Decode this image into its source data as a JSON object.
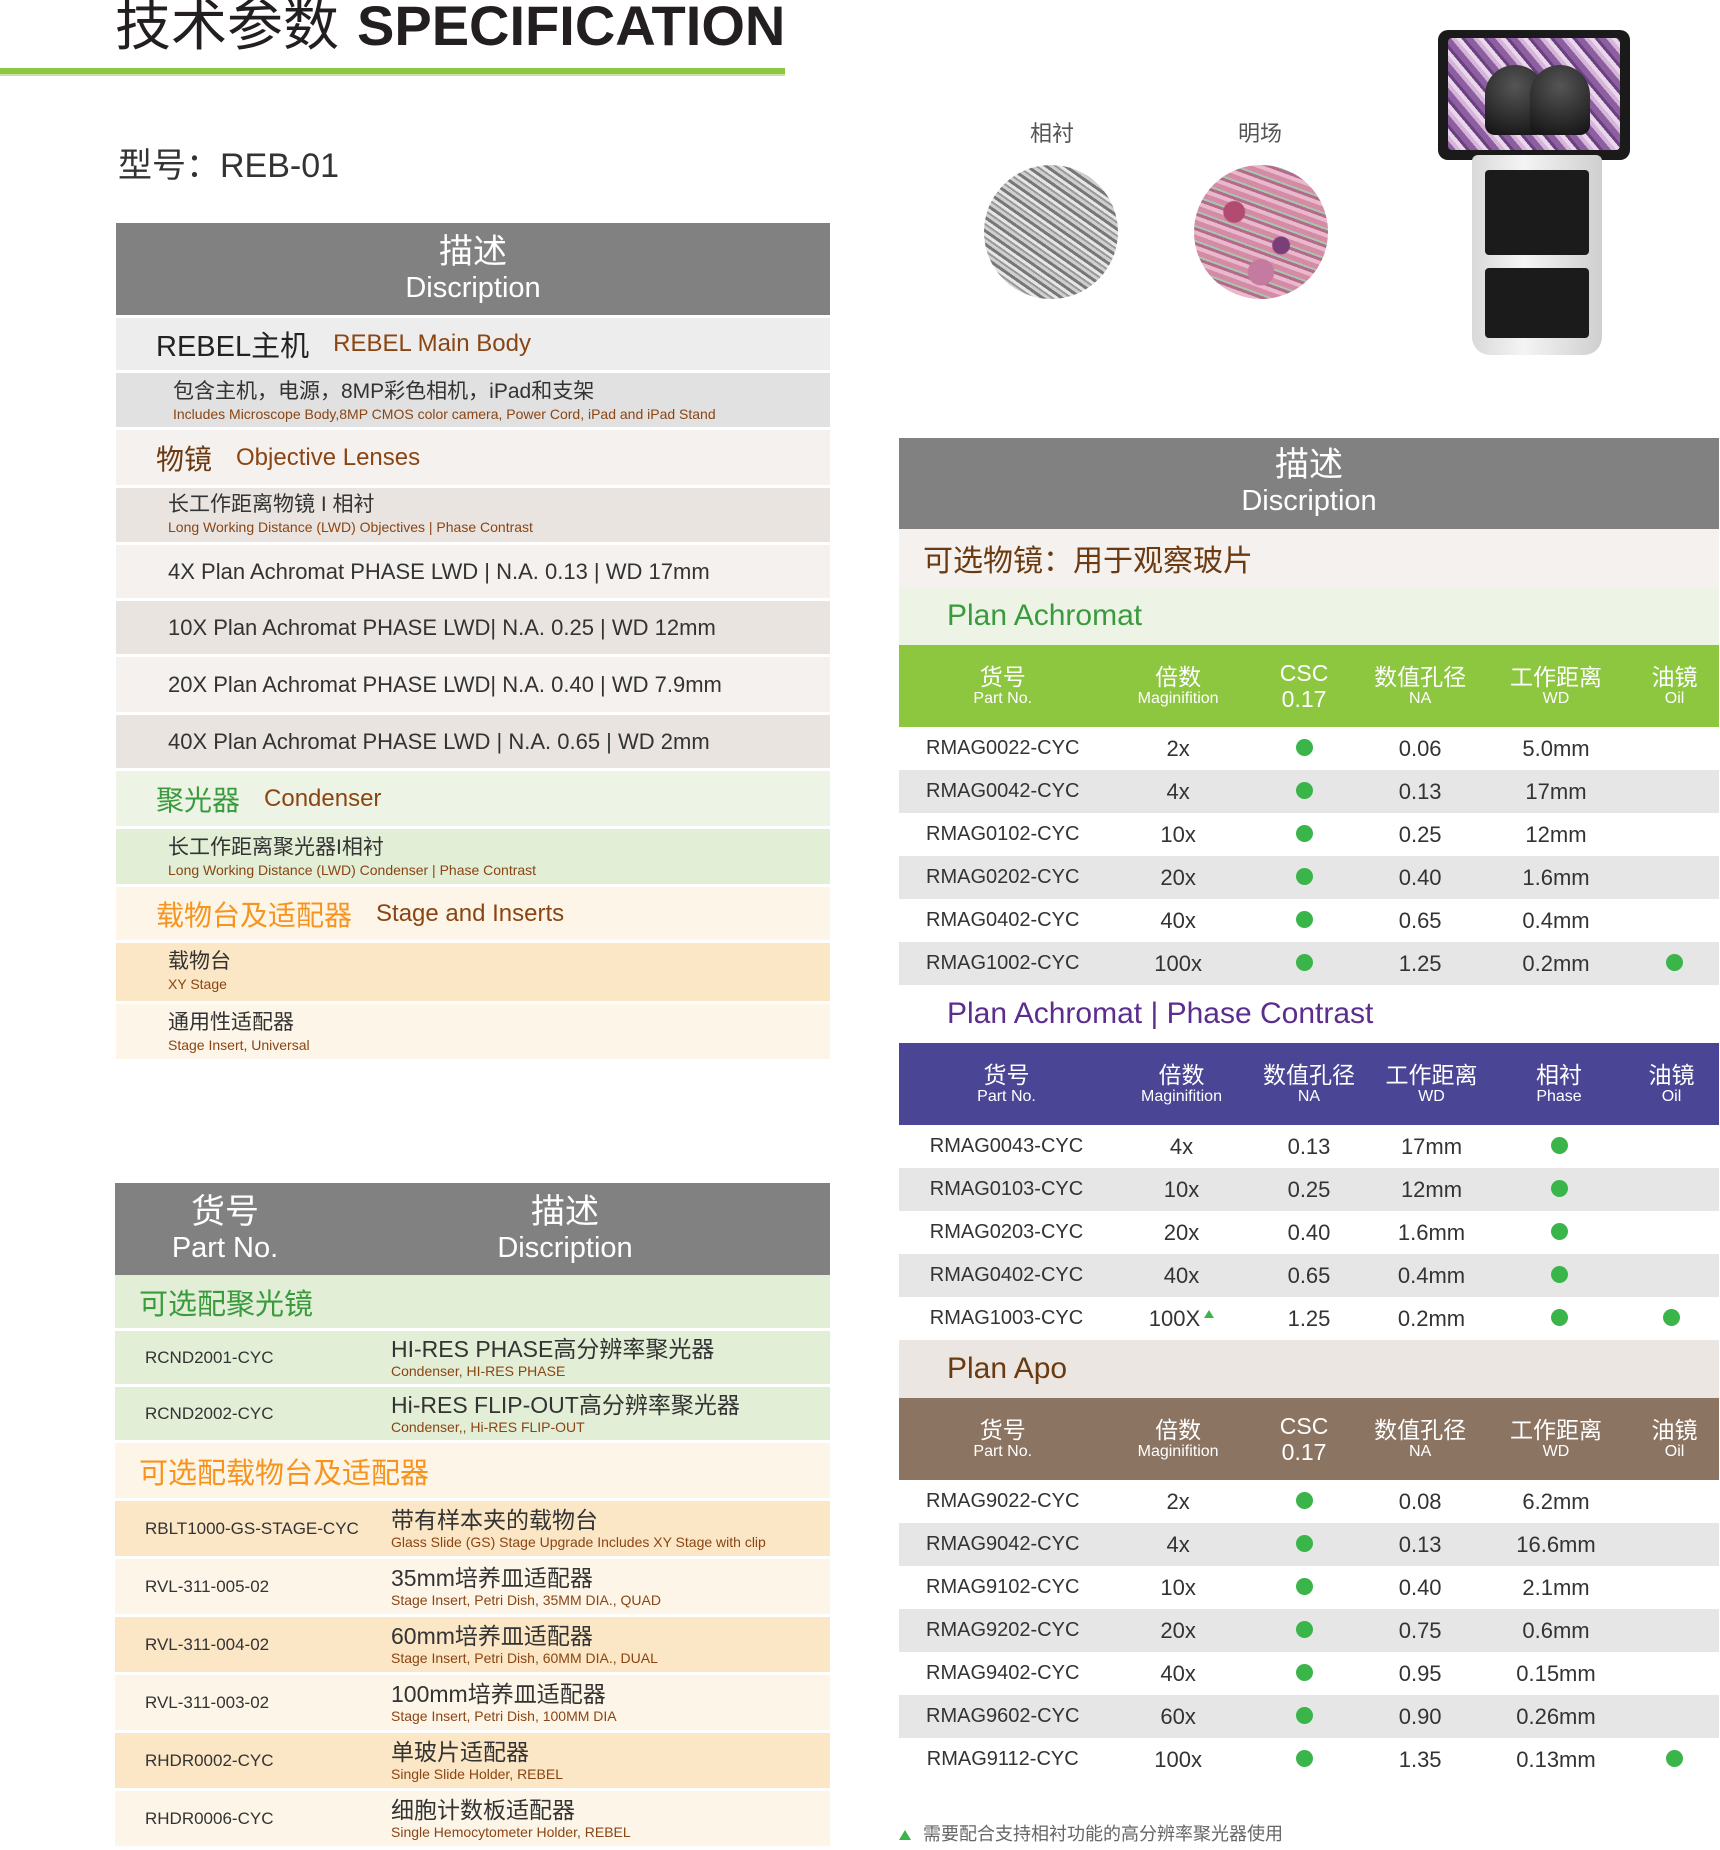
{
  "header": {
    "title_zh": "技术参数",
    "title_en": "SPECIFICATION",
    "model": "型号：REB-01"
  },
  "desc_table": {
    "header_zh": "描述",
    "header_en": "Discription",
    "main_body": {
      "zh": "REBEL主机",
      "en": "REBEL Main Body",
      "item_zh": "包含主机，电源，8MP彩色相机，iPad和支架",
      "item_en": "Includes Microscope Body,8MP CMOS color camera, Power Cord, iPad and iPad Stand"
    },
    "objectives": {
      "zh": "物镜",
      "en": "Objective Lenses",
      "item_zh": "长工作距离物镜 I 相衬",
      "item_en": "Long Working Distance (LWD) Objectives | Phase Contrast",
      "specs": [
        "4X Plan Achromat PHASE  LWD | N.A. 0.13 | WD 17mm",
        "10X Plan Achromat PHASE  LWD| N.A. 0.25 | WD 12mm",
        "20X Plan Achromat PHASE  LWD| N.A. 0.40 | WD 7.9mm",
        "40X Plan Achromat PHASE  LWD | N.A. 0.65 | WD 2mm"
      ]
    },
    "condenser": {
      "zh": "聚光器",
      "en": "Condenser",
      "item_zh": "长工作距离聚光器I相衬",
      "item_en": "Long Working Distance (LWD) Condenser | Phase Contrast"
    },
    "stage": {
      "zh": "载物台及适配器",
      "en": "Stage and Inserts",
      "items": [
        {
          "zh": "载物台",
          "en": "XY Stage"
        },
        {
          "zh": "通用性适配器",
          "en": "Stage Insert, Universal"
        }
      ]
    }
  },
  "parts_table": {
    "col1_zh": "货号",
    "col1_en": "Part No.",
    "col2_zh": "描述",
    "col2_en": "Discription",
    "sections": [
      {
        "title": "可选配聚光镜",
        "color": "#3a9b3e",
        "bg": "#e2eed6",
        "row_bg": "#e2eed6",
        "rows": [
          {
            "pn": "RCND2001-CYC",
            "zh": "HI-RES PHASE高分辨率聚光器",
            "en": "Condenser, HI-RES PHASE"
          },
          {
            "pn": "RCND2002-CYC",
            "zh": "Hi-RES FLIP-OUT高分辨率聚光器",
            "en": "Condenser,, Hi-RES FLIP-OUT"
          }
        ]
      },
      {
        "title": "可选配载物台及适配器",
        "color": "#f7941d",
        "bg": "#fdf5e8",
        "row_bg": "#fdf5e8",
        "rows": [
          {
            "pn": "RBLT1000-GS-STAGE-CYC",
            "zh": "带有样本夹的载物台",
            "en": "Glass Slide (GS) Stage Upgrade Includes XY Stage with clip"
          },
          {
            "pn": "RVL-311-005-02",
            "zh": "35mm培养皿适配器",
            "en": "Stage Insert, Petri Dish, 35MM DIA., QUAD"
          },
          {
            "pn": "RVL-311-004-02",
            "zh": "60mm培养皿适配器",
            "en": "Stage Insert, Petri Dish, 60MM DIA., DUAL"
          },
          {
            "pn": "RVL-311-003-02",
            "zh": "100mm培养皿适配器",
            "en": "Stage Insert, Petri Dish, 100MM DIA"
          },
          {
            "pn": "RHDR0002-CYC",
            "zh": "单玻片适配器",
            "en": "Single Slide Holder, REBEL"
          },
          {
            "pn": "RHDR0006-CYC",
            "zh": "细胞计数板适配器",
            "en": "Single Hemocytometer Holder, REBEL"
          }
        ]
      }
    ]
  },
  "images": {
    "phase_label": "相衬",
    "bright_label": "明场"
  },
  "right_table": {
    "header_zh": "描述",
    "header_en": "Discription",
    "title": "可选物镜：用于观察玻片",
    "plan_achromat": {
      "title": "Plan Achromat",
      "cols": [
        {
          "zh": "货号",
          "en": "Part No."
        },
        {
          "zh": "倍数",
          "en": "Maginifition"
        },
        {
          "zh": "CSC",
          "en": "0.17"
        },
        {
          "zh": "数值孔径",
          "en": "NA"
        },
        {
          "zh": "工作距离",
          "en": "WD"
        },
        {
          "zh": "油镜",
          "en": "Oil"
        }
      ],
      "rows": [
        {
          "pn": "RMAG0022-CYC",
          "mag": "2x",
          "na": "0.06",
          "wd": "5.0mm",
          "oil": false
        },
        {
          "pn": "RMAG0042-CYC",
          "mag": "4x",
          "na": "0.13",
          "wd": "17mm",
          "oil": false
        },
        {
          "pn": "RMAG0102-CYC",
          "mag": "10x",
          "na": "0.25",
          "wd": "12mm",
          "oil": false
        },
        {
          "pn": "RMAG0202-CYC",
          "mag": "20x",
          "na": "0.40",
          "wd": "1.6mm",
          "oil": false
        },
        {
          "pn": "RMAG0402-CYC",
          "mag": "40x",
          "na": "0.65",
          "wd": "0.4mm",
          "oil": false
        },
        {
          "pn": "RMAG1002-CYC",
          "mag": "100x",
          "na": "1.25",
          "wd": "0.2mm",
          "oil": true
        }
      ]
    },
    "phase_contrast": {
      "title": "Plan Achromat | Phase Contrast",
      "cols": [
        {
          "zh": "货号",
          "en": "Part No."
        },
        {
          "zh": "倍数",
          "en": "Maginifition"
        },
        {
          "zh": "数值孔径",
          "en": "NA"
        },
        {
          "zh": "工作距离",
          "en": "WD"
        },
        {
          "zh": "相衬",
          "en": "Phase"
        },
        {
          "zh": "油镜",
          "en": "Oil"
        }
      ],
      "rows": [
        {
          "pn": "RMAG0043-CYC",
          "mag": "4x",
          "na": "0.13",
          "wd": "17mm",
          "oil": false
        },
        {
          "pn": "RMAG0103-CYC",
          "mag": "10x",
          "na": "0.25",
          "wd": "12mm",
          "oil": false
        },
        {
          "pn": "RMAG0203-CYC",
          "mag": "20x",
          "na": "0.40",
          "wd": "1.6mm",
          "oil": false
        },
        {
          "pn": "RMAG0402-CYC",
          "mag": "40x",
          "na": "0.65",
          "wd": "0.4mm",
          "oil": false
        },
        {
          "pn": "RMAG1003-CYC",
          "mag": "100X",
          "na": "1.25",
          "wd": "0.2mm",
          "oil": true
        }
      ]
    },
    "plan_apo": {
      "title": "Plan Apo",
      "cols": [
        {
          "zh": "货号",
          "en": "Part No."
        },
        {
          "zh": "倍数",
          "en": "Maginifition"
        },
        {
          "zh": "CSC",
          "en": "0.17"
        },
        {
          "zh": "数值孔径",
          "en": "NA"
        },
        {
          "zh": "工作距离",
          "en": "WD"
        },
        {
          "zh": "油镜",
          "en": "Oil"
        }
      ],
      "rows": [
        {
          "pn": "RMAG9022-CYC",
          "mag": "2x",
          "na": "0.08",
          "wd": "6.2mm",
          "oil": false
        },
        {
          "pn": "RMAG9042-CYC",
          "mag": "4x",
          "na": "0.13",
          "wd": "16.6mm",
          "oil": false
        },
        {
          "pn": "RMAG9102-CYC",
          "mag": "10x",
          "na": "0.40",
          "wd": "2.1mm",
          "oil": false
        },
        {
          "pn": "RMAG9202-CYC",
          "mag": "20x",
          "na": "0.75",
          "wd": "0.6mm",
          "oil": false
        },
        {
          "pn": "RMAG9402-CYC",
          "mag": "40x",
          "na": "0.95",
          "wd": "0.15mm",
          "oil": false
        },
        {
          "pn": "RMAG9602-CYC",
          "mag": "60x",
          "na": "0.90",
          "wd": "0.26mm",
          "oil": false
        },
        {
          "pn": "RMAG9112-CYC",
          "mag": "100x",
          "na": "1.35",
          "wd": "0.13mm",
          "oil": true
        }
      ]
    },
    "note": "需要配合支持相衬功能的高分辨率聚光器使用"
  }
}
